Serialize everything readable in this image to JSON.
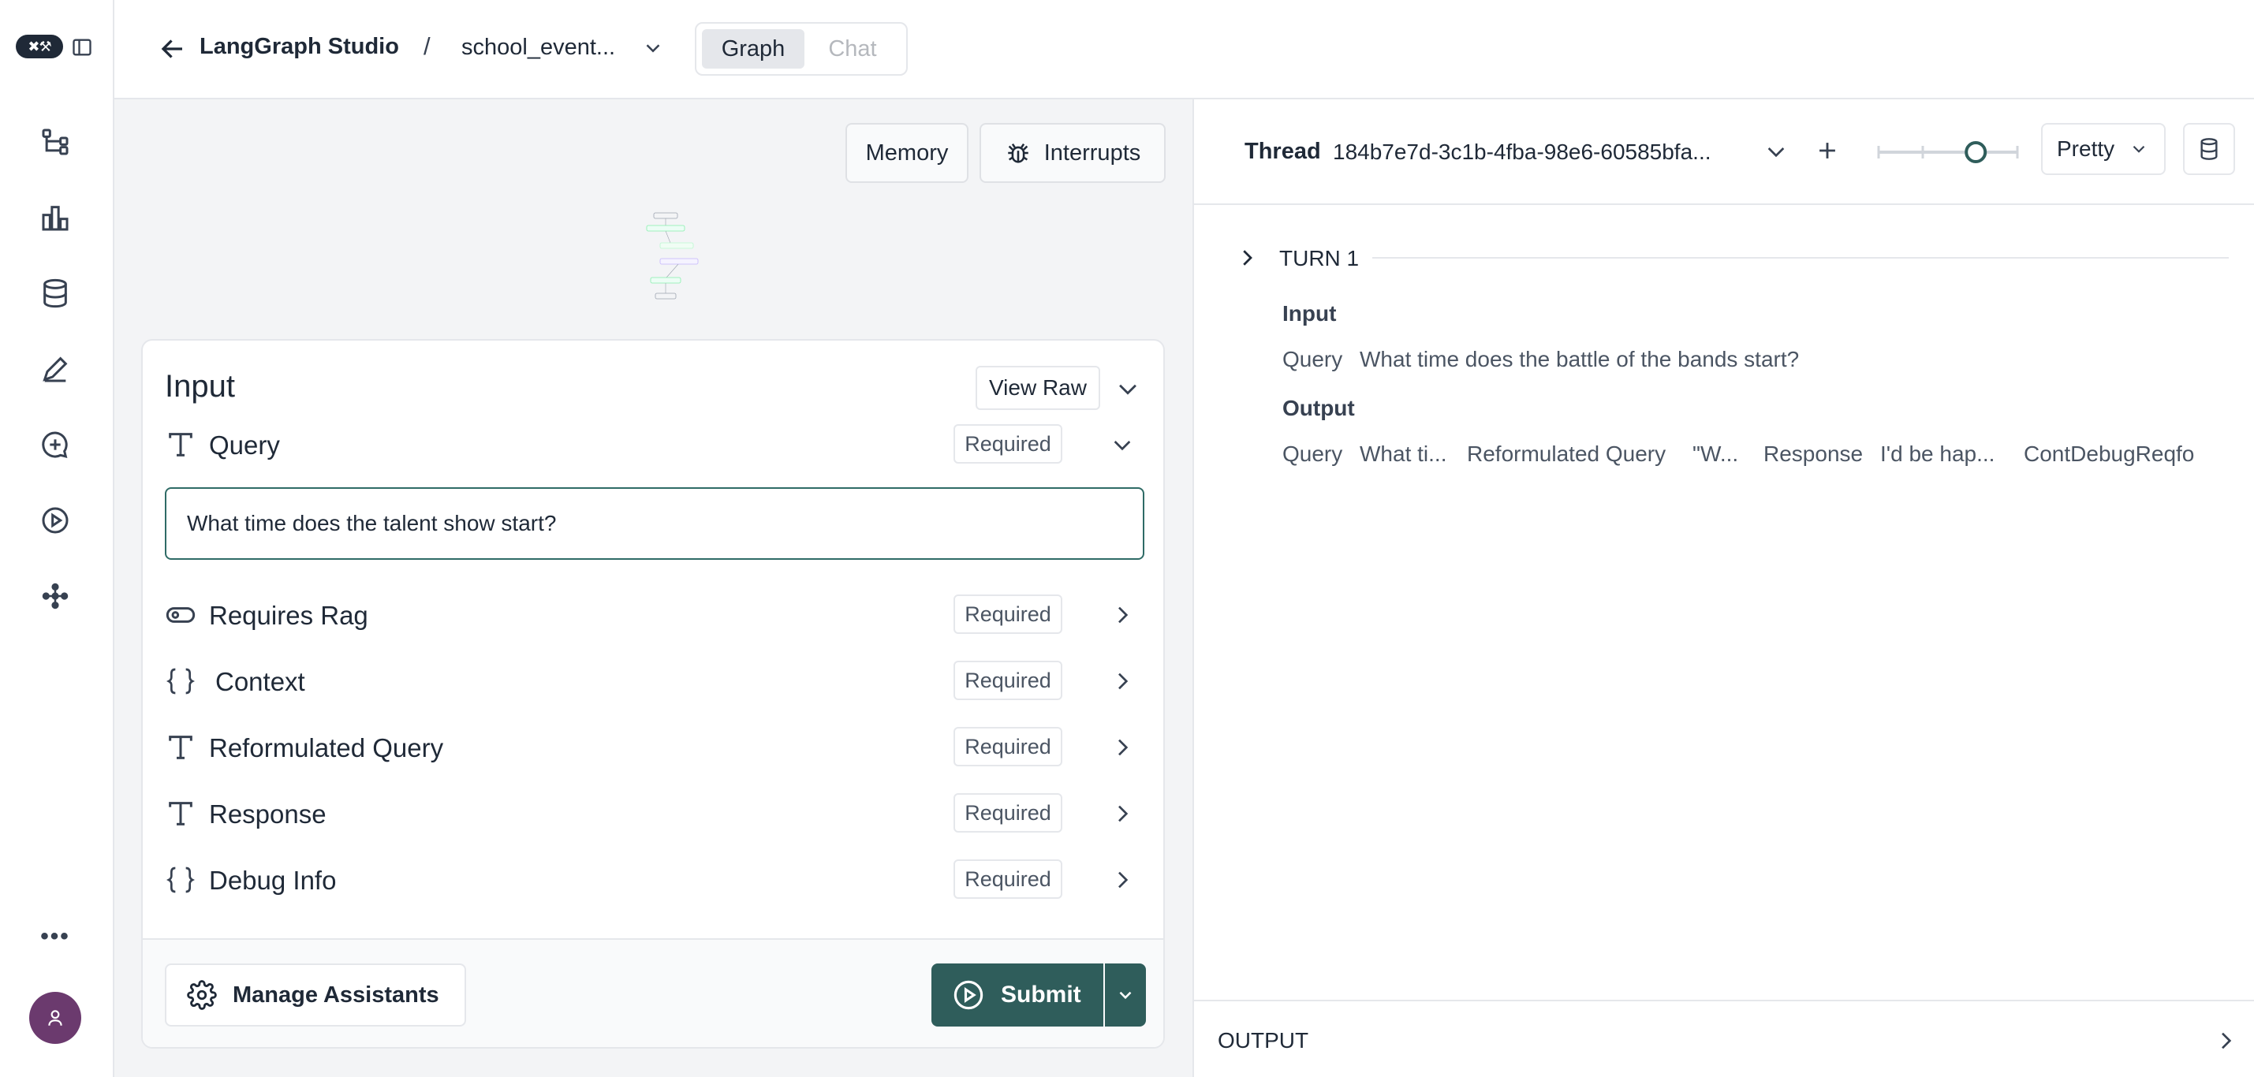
{
  "rail": {
    "logo_text": "✖⚒",
    "items": [
      "graph-icon",
      "chart-bar-icon",
      "database-icon",
      "pen-icon",
      "chat-plus-icon",
      "play-circle-icon",
      "nodes-icon"
    ],
    "more": "•••"
  },
  "header": {
    "app_title": "LangGraph Studio",
    "separator": "/",
    "graph_name": "school_event...",
    "tabs": [
      {
        "label": "Graph",
        "active": true
      },
      {
        "label": "Chat",
        "active": false
      }
    ]
  },
  "graph_pane": {
    "memory_label": "Memory",
    "interrupts_label": "Interrupts"
  },
  "input_card": {
    "title": "Input",
    "view_raw_label": "View Raw",
    "query": {
      "label": "Query",
      "required": "Required",
      "value": "What time does the talent show start?"
    },
    "fields": [
      {
        "icon": "toggle-icon",
        "label": "Requires Rag",
        "required": "Required"
      },
      {
        "icon": "braces-icon",
        "label": "Context",
        "required": "Required"
      },
      {
        "icon": "text-type-icon",
        "label": "Reformulated Query",
        "required": "Required"
      },
      {
        "icon": "text-type-icon",
        "label": "Response",
        "required": "Required"
      },
      {
        "icon": "braces-icon",
        "label": "Debug Info",
        "required": "Required"
      }
    ],
    "manage_label": "Manage Assistants",
    "submit_label": "Submit"
  },
  "thread": {
    "label": "Thread",
    "id": "184b7e7d-3c1b-4fba-98e6-60585bfa...",
    "view_mode": "Pretty",
    "slider_value": 0.7
  },
  "turn": {
    "label": "TURN 1",
    "input_heading": "Input",
    "input_query_key": "Query",
    "input_query_value": "What time does the battle of the bands start?",
    "output_heading": "Output",
    "output_items": [
      {
        "key": "Query",
        "value": "What ti..."
      },
      {
        "key": "Reformulated Query",
        "value": "\"W..."
      },
      {
        "key": "Response",
        "value": "I'd be hap..."
      },
      {
        "key": "Context",
        "value": ""
      },
      {
        "key": "Debug Info",
        "value": ""
      }
    ],
    "overlap_text": "ContDebugReqfo"
  },
  "output_bar": {
    "label": "OUTPUT"
  },
  "colors": {
    "accent": "#2f5d5b",
    "input_border": "#2f6b66",
    "avatar": "#6b3a6e"
  }
}
